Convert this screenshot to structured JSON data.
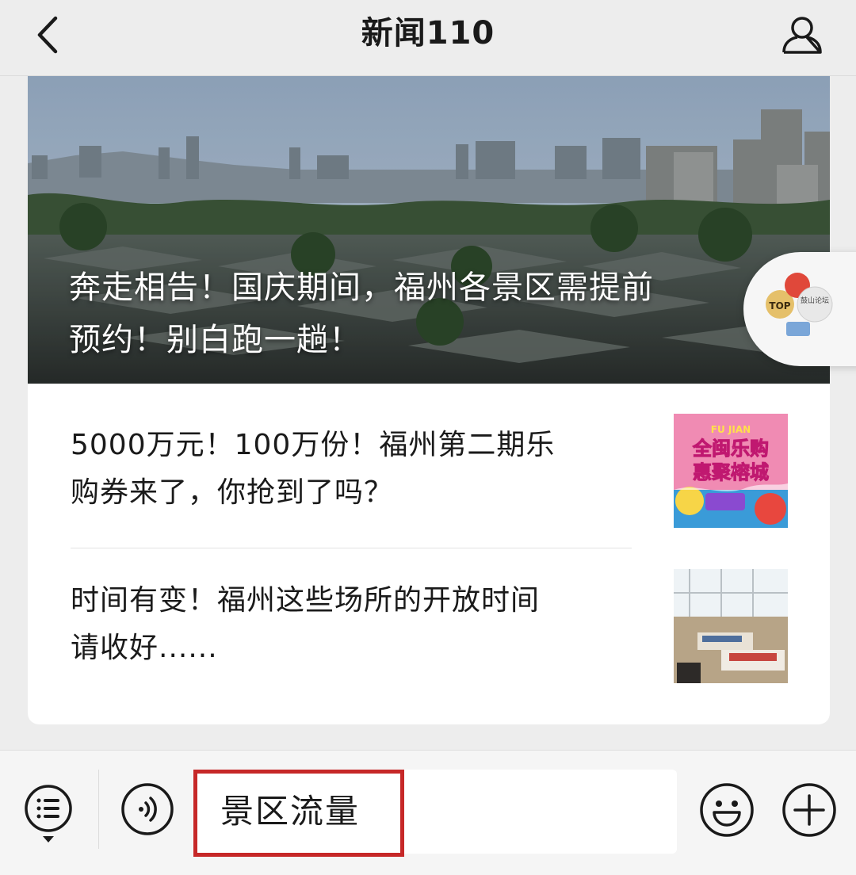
{
  "header": {
    "title": "新闻110"
  },
  "icons": {
    "back": "chevron-left-icon",
    "profile": "person-icon",
    "menu": "list-menu-icon",
    "voice": "voice-icon",
    "emoji": "smiley-icon",
    "plus": "plus-icon"
  },
  "articles": {
    "hero": {
      "title_line1": "奔走相告！国庆期间，福州各景区需提前",
      "title_line2": "预约！别白跑一趟！"
    },
    "items": [
      {
        "line1": "5000万元！100万份！福州第二期乐",
        "line2": "购券来了，你抢到了吗？",
        "thumb_label_top": "FU JIAN",
        "thumb_label_1": "全闽乐购",
        "thumb_label_2": "惠聚榕城"
      },
      {
        "line1": "时间有变！福州这些场所的开放时间",
        "line2": "请收好......"
      }
    ]
  },
  "float_badge": {
    "text_top": "TOP",
    "text_right": "鼓山论坛"
  },
  "input": {
    "value": "景区流量"
  },
  "colors": {
    "background": "#ededed",
    "highlight": "#c62828",
    "card": "#ffffff"
  }
}
